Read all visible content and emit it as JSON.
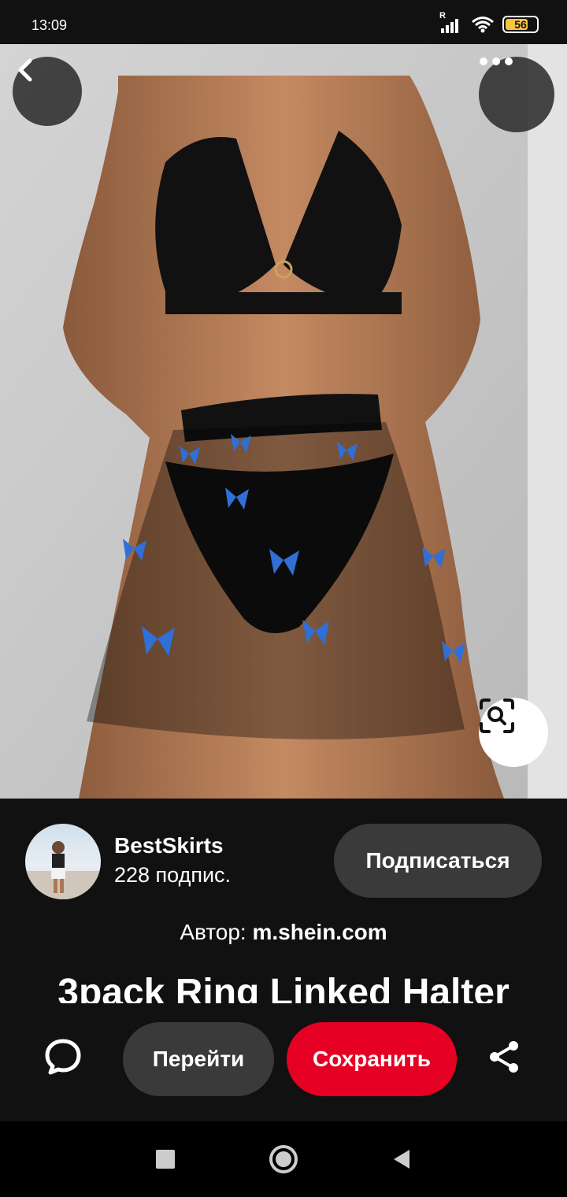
{
  "status_bar": {
    "time": "13:09",
    "battery": "56",
    "signal_label": "R"
  },
  "pin": {
    "back_icon": "chevron-left-icon",
    "more_icon": "more-horizontal-icon",
    "lens_icon": "visual-search-icon"
  },
  "creator": {
    "name": "BestSkirts",
    "followers": "228 подпис.",
    "subscribe_label": "Подписаться"
  },
  "source": {
    "prefix": "Автор: ",
    "domain": "m.shein.com"
  },
  "title": "3pack Ring Linked Halter",
  "actions": {
    "comment_icon": "comment-icon",
    "go_label": "Перейти",
    "save_label": "Сохранить",
    "share_icon": "share-icon"
  },
  "colors": {
    "save_red": "#e60023",
    "button_dark": "#3a3a3a",
    "background": "#111111"
  },
  "nav": {
    "recent_icon": "square-recents-icon",
    "home_icon": "circle-home-icon",
    "back_icon": "triangle-back-icon"
  }
}
